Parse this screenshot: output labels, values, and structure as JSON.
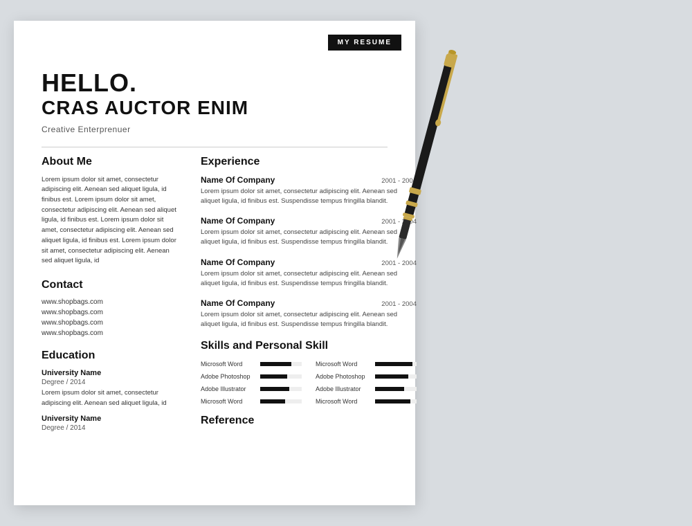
{
  "badge": "MY RESUME",
  "header": {
    "hello": "HELLO.",
    "fullname": "CRAS AUCTOR ENIM",
    "title": "Creative Enterprenuer"
  },
  "about": {
    "title": "About Me",
    "text": "Lorem ipsum dolor sit amet, consectetur adipiscing elit. Aenean sed aliquet ligula, id finibus est. Lorem ipsum dolor sit amet, consectetur adipiscing elit. Aenean sed aliquet ligula, id finibus est. Lorem ipsum dolor sit amet, consectetur adipiscing elit. Aenean sed aliquet ligula, id finibus est. Lorem ipsum dolor sit amet, consectetur adipiscing elit. Aenean sed aliquet ligula, id"
  },
  "contact": {
    "title": "Contact",
    "links": [
      "www.shopbags.com",
      "www.shopbags.com",
      "www.shopbags.com",
      "www.shopbags.com"
    ]
  },
  "education": {
    "title": "Education",
    "entries": [
      {
        "university": "University Name",
        "degree": "Degree / 2014",
        "text": "Lorem ipsum dolor sit amet, consectetur adipiscing elit. Aenean sed aliquet ligula, id"
      },
      {
        "university": "University Name",
        "degree": "Degree / 2014",
        "text": ""
      }
    ]
  },
  "experience": {
    "title": "Experience",
    "entries": [
      {
        "company": "Name Of Company",
        "dates": "2001 - 2004",
        "desc": "Lorem ipsum dolor sit amet, consectetur adipiscing elit. Aenean sed aliquet ligula, id finibus est. Suspendisse tempus fringilla blandit."
      },
      {
        "company": "Name Of Company",
        "dates": "2001 - 2004",
        "desc": "Lorem ipsum dolor sit amet, consectetur adipiscing elit. Aenean sed aliquet ligula, id finibus est. Suspendisse tempus fringilla blandit."
      },
      {
        "company": "Name Of Company",
        "dates": "2001 - 2004",
        "desc": "Lorem ipsum dolor sit amet, consectetur adipiscing elit. Aenean sed aliquet ligula, id finibus est. Suspendisse tempus fringilla blandit."
      },
      {
        "company": "Name Of Company",
        "dates": "2001 - 2004",
        "desc": "Lorem ipsum dolor sit amet, consectetur adipiscing elit. Aenean sed aliquet ligula, id finibus est. Suspendisse tempus fringilla blandit."
      }
    ]
  },
  "skills": {
    "title": "Skills and Personal Skill",
    "items": [
      {
        "label": "Microsoft  Word",
        "pct": 75
      },
      {
        "label": "Microsoft  Word",
        "pct": 90
      },
      {
        "label": "Adobe Photoshop",
        "pct": 65
      },
      {
        "label": "Adobe Photoshop",
        "pct": 80
      },
      {
        "label": "Adobe Illustrator",
        "pct": 70
      },
      {
        "label": "Adobe Illustrator",
        "pct": 70
      },
      {
        "label": "Microsoft  Word",
        "pct": 60
      },
      {
        "label": "Microsoft  Word",
        "pct": 85
      }
    ]
  },
  "reference": {
    "title": "Reference"
  }
}
